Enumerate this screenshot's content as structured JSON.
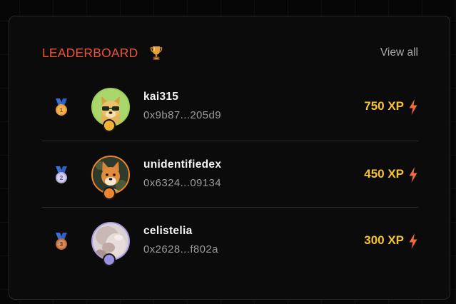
{
  "leaderboard": {
    "title": "LEADERBOARD",
    "title_icon": "trophy-icon",
    "view_all_label": "View all",
    "accent_color": "#f0522e",
    "xp_color": "#f7c334",
    "entries": [
      {
        "rank": "1",
        "medal_icon": "gold-medal-icon",
        "name": "kai315",
        "address": "0x9b87...205d9",
        "xp": "750 XP",
        "avatar": "doge-sunglasses-avatar"
      },
      {
        "rank": "2",
        "medal_icon": "silver-medal-icon",
        "name": "unidentifiedex",
        "address": "0x6324...09134",
        "xp": "450 XP",
        "avatar": "shiba-avatar"
      },
      {
        "rank": "3",
        "medal_icon": "bronze-medal-icon",
        "name": "celistelia",
        "address": "0x2628...f802a",
        "xp": "300 XP",
        "avatar": "photo-avatar"
      }
    ]
  }
}
